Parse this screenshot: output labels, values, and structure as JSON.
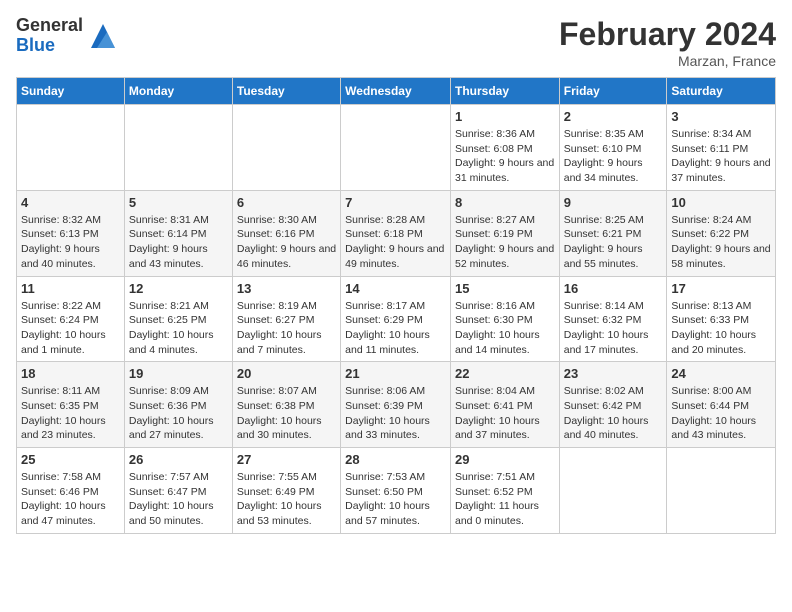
{
  "logo": {
    "general": "General",
    "blue": "Blue"
  },
  "title": "February 2024",
  "subtitle": "Marzan, France",
  "days_of_week": [
    "Sunday",
    "Monday",
    "Tuesday",
    "Wednesday",
    "Thursday",
    "Friday",
    "Saturday"
  ],
  "weeks": [
    [
      {
        "day": "",
        "info": ""
      },
      {
        "day": "",
        "info": ""
      },
      {
        "day": "",
        "info": ""
      },
      {
        "day": "",
        "info": ""
      },
      {
        "day": "1",
        "info": "Sunrise: 8:36 AM\nSunset: 6:08 PM\nDaylight: 9 hours and 31 minutes."
      },
      {
        "day": "2",
        "info": "Sunrise: 8:35 AM\nSunset: 6:10 PM\nDaylight: 9 hours and 34 minutes."
      },
      {
        "day": "3",
        "info": "Sunrise: 8:34 AM\nSunset: 6:11 PM\nDaylight: 9 hours and 37 minutes."
      }
    ],
    [
      {
        "day": "4",
        "info": "Sunrise: 8:32 AM\nSunset: 6:13 PM\nDaylight: 9 hours and 40 minutes."
      },
      {
        "day": "5",
        "info": "Sunrise: 8:31 AM\nSunset: 6:14 PM\nDaylight: 9 hours and 43 minutes."
      },
      {
        "day": "6",
        "info": "Sunrise: 8:30 AM\nSunset: 6:16 PM\nDaylight: 9 hours and 46 minutes."
      },
      {
        "day": "7",
        "info": "Sunrise: 8:28 AM\nSunset: 6:18 PM\nDaylight: 9 hours and 49 minutes."
      },
      {
        "day": "8",
        "info": "Sunrise: 8:27 AM\nSunset: 6:19 PM\nDaylight: 9 hours and 52 minutes."
      },
      {
        "day": "9",
        "info": "Sunrise: 8:25 AM\nSunset: 6:21 PM\nDaylight: 9 hours and 55 minutes."
      },
      {
        "day": "10",
        "info": "Sunrise: 8:24 AM\nSunset: 6:22 PM\nDaylight: 9 hours and 58 minutes."
      }
    ],
    [
      {
        "day": "11",
        "info": "Sunrise: 8:22 AM\nSunset: 6:24 PM\nDaylight: 10 hours and 1 minute."
      },
      {
        "day": "12",
        "info": "Sunrise: 8:21 AM\nSunset: 6:25 PM\nDaylight: 10 hours and 4 minutes."
      },
      {
        "day": "13",
        "info": "Sunrise: 8:19 AM\nSunset: 6:27 PM\nDaylight: 10 hours and 7 minutes."
      },
      {
        "day": "14",
        "info": "Sunrise: 8:17 AM\nSunset: 6:29 PM\nDaylight: 10 hours and 11 minutes."
      },
      {
        "day": "15",
        "info": "Sunrise: 8:16 AM\nSunset: 6:30 PM\nDaylight: 10 hours and 14 minutes."
      },
      {
        "day": "16",
        "info": "Sunrise: 8:14 AM\nSunset: 6:32 PM\nDaylight: 10 hours and 17 minutes."
      },
      {
        "day": "17",
        "info": "Sunrise: 8:13 AM\nSunset: 6:33 PM\nDaylight: 10 hours and 20 minutes."
      }
    ],
    [
      {
        "day": "18",
        "info": "Sunrise: 8:11 AM\nSunset: 6:35 PM\nDaylight: 10 hours and 23 minutes."
      },
      {
        "day": "19",
        "info": "Sunrise: 8:09 AM\nSunset: 6:36 PM\nDaylight: 10 hours and 27 minutes."
      },
      {
        "day": "20",
        "info": "Sunrise: 8:07 AM\nSunset: 6:38 PM\nDaylight: 10 hours and 30 minutes."
      },
      {
        "day": "21",
        "info": "Sunrise: 8:06 AM\nSunset: 6:39 PM\nDaylight: 10 hours and 33 minutes."
      },
      {
        "day": "22",
        "info": "Sunrise: 8:04 AM\nSunset: 6:41 PM\nDaylight: 10 hours and 37 minutes."
      },
      {
        "day": "23",
        "info": "Sunrise: 8:02 AM\nSunset: 6:42 PM\nDaylight: 10 hours and 40 minutes."
      },
      {
        "day": "24",
        "info": "Sunrise: 8:00 AM\nSunset: 6:44 PM\nDaylight: 10 hours and 43 minutes."
      }
    ],
    [
      {
        "day": "25",
        "info": "Sunrise: 7:58 AM\nSunset: 6:46 PM\nDaylight: 10 hours and 47 minutes."
      },
      {
        "day": "26",
        "info": "Sunrise: 7:57 AM\nSunset: 6:47 PM\nDaylight: 10 hours and 50 minutes."
      },
      {
        "day": "27",
        "info": "Sunrise: 7:55 AM\nSunset: 6:49 PM\nDaylight: 10 hours and 53 minutes."
      },
      {
        "day": "28",
        "info": "Sunrise: 7:53 AM\nSunset: 6:50 PM\nDaylight: 10 hours and 57 minutes."
      },
      {
        "day": "29",
        "info": "Sunrise: 7:51 AM\nSunset: 6:52 PM\nDaylight: 11 hours and 0 minutes."
      },
      {
        "day": "",
        "info": ""
      },
      {
        "day": "",
        "info": ""
      }
    ]
  ]
}
